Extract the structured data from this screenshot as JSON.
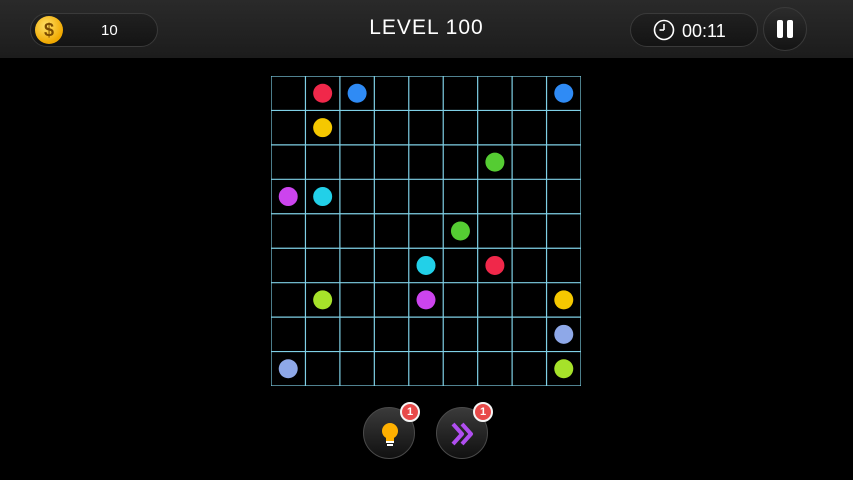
{
  "header": {
    "coins": "10",
    "level_title": "LEVEL 100",
    "timer": "00:11"
  },
  "board": {
    "rows": 9,
    "cols": 9,
    "grid_color": "#7fd0e6",
    "dots": [
      {
        "row": 0,
        "col": 1,
        "color": "#f0284a",
        "name": "red"
      },
      {
        "row": 0,
        "col": 2,
        "color": "#2f8bf5",
        "name": "blue"
      },
      {
        "row": 0,
        "col": 8,
        "color": "#2f8bf5",
        "name": "blue"
      },
      {
        "row": 1,
        "col": 1,
        "color": "#f5c800",
        "name": "yellow"
      },
      {
        "row": 2,
        "col": 6,
        "color": "#55cc33",
        "name": "green"
      },
      {
        "row": 3,
        "col": 0,
        "color": "#cc44ee",
        "name": "purple"
      },
      {
        "row": 3,
        "col": 1,
        "color": "#22d0e8",
        "name": "cyan"
      },
      {
        "row": 4,
        "col": 5,
        "color": "#55cc33",
        "name": "green"
      },
      {
        "row": 5,
        "col": 4,
        "color": "#22d0e8",
        "name": "cyan"
      },
      {
        "row": 5,
        "col": 6,
        "color": "#f0284a",
        "name": "red"
      },
      {
        "row": 6,
        "col": 1,
        "color": "#a6e22a",
        "name": "lime"
      },
      {
        "row": 6,
        "col": 4,
        "color": "#cc44ee",
        "name": "purple"
      },
      {
        "row": 6,
        "col": 8,
        "color": "#f5c800",
        "name": "yellow"
      },
      {
        "row": 7,
        "col": 8,
        "color": "#8ea8e8",
        "name": "periwinkle"
      },
      {
        "row": 8,
        "col": 0,
        "color": "#8ea8e8",
        "name": "periwinkle"
      },
      {
        "row": 8,
        "col": 8,
        "color": "#a6e22a",
        "name": "lime"
      }
    ]
  },
  "tools": {
    "hint_count": "1",
    "skip_count": "1"
  }
}
